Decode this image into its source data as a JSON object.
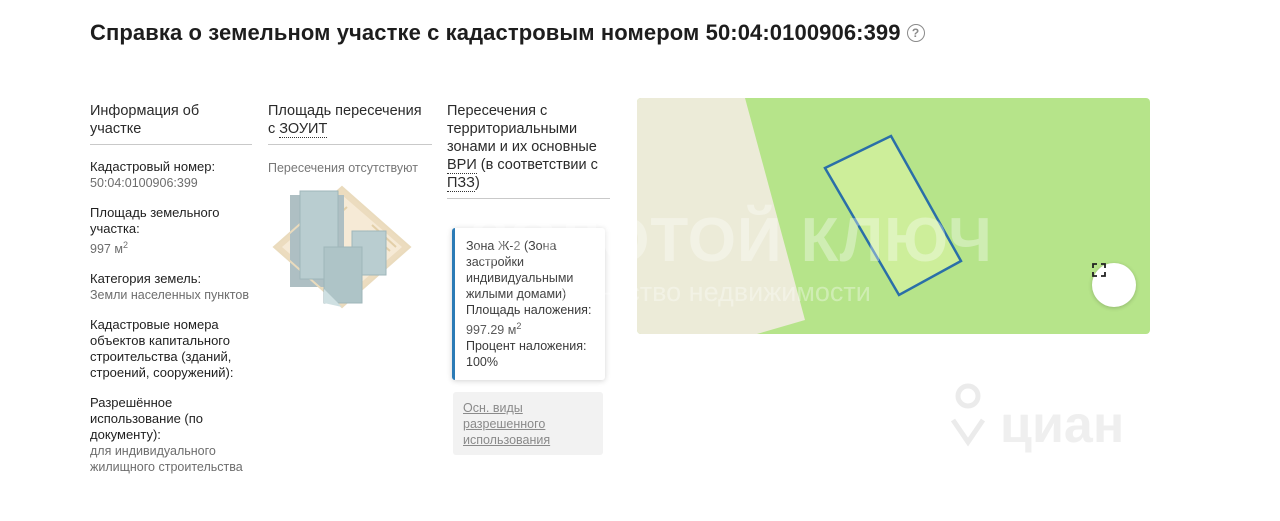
{
  "title": "Справка о земельном участке с кадастровым номером 50:04:0100906:399",
  "help_icon": "question-circle-icon",
  "columns": {
    "info_header": "Информация об участке",
    "area_header_prefix": "Площадь пересечения с ",
    "area_header_link": "ЗОУИТ",
    "zones_header_1": "Пересечения с территориальными зонами и их основные ",
    "zones_header_vri": "ВРИ",
    "zones_header_2": " (в соответствии с ",
    "zones_header_pzz": "ПЗЗ",
    "zones_header_3": ")"
  },
  "info": {
    "cad_label": "Кадастровый номер:",
    "cad_value": "50:04:0100906:399",
    "area_label": "Площадь земельного участка:",
    "area_value": "997 м",
    "area_sup": "2",
    "category_label": "Категория земель:",
    "category_value": "Земли населенных пунктов",
    "capital_label": "Кадастровые номера объектов капитального строительства (зданий, строений, сооружений):",
    "usage_label": "Разрешённое использование (по документу):",
    "usage_value": "для индивидуального жилищного строительства"
  },
  "zouit": {
    "no_intersections": "Пересечения отсутствуют"
  },
  "zone": {
    "name": "Зона Ж-2 (Зона застройки индивидуальными жилыми домами)",
    "overlap_area_label": "Площадь наложения:",
    "overlap_area_value": "997.29 м",
    "overlap_area_sup": "2",
    "overlap_percent_label": "Процент наложения:",
    "overlap_percent_value": "100%",
    "link_label": "Осн. виды разрешенного использования"
  },
  "watermarks": {
    "title": "ЗОЛОТОЙ КЛЮЧ",
    "subtitle": "агентство недвижимости",
    "cian": "циан"
  },
  "colors": {
    "map_green": "#b6e48a",
    "map_beige": "#ecebd8",
    "parcel_border": "#2a6fa8",
    "zone_accent": "#2b7bb6"
  }
}
